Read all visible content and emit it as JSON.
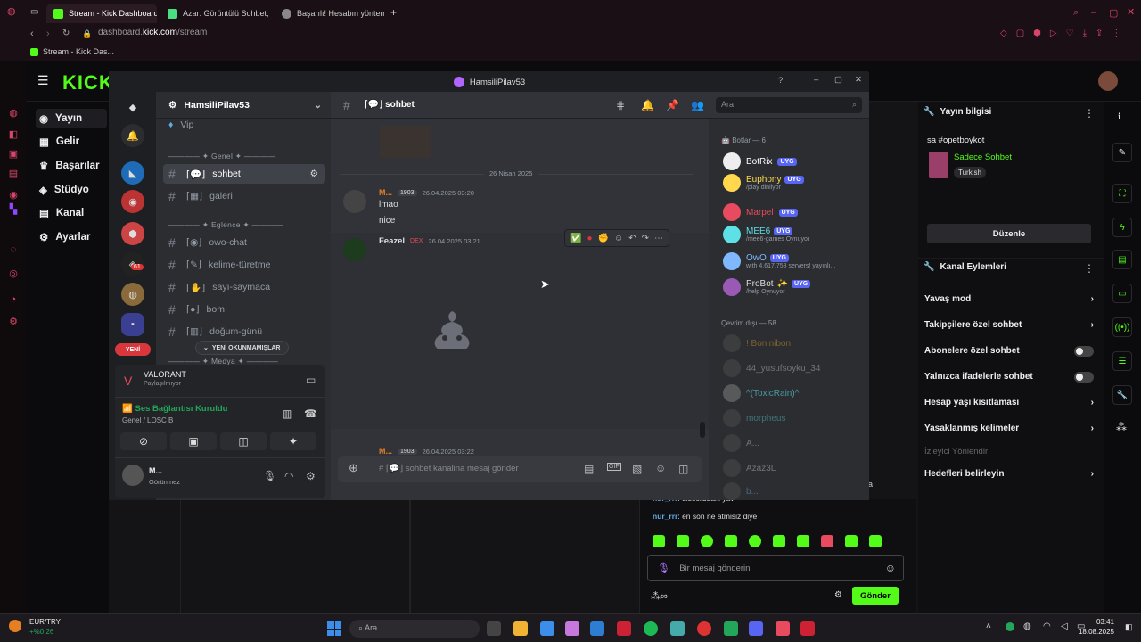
{
  "browser": {
    "tabs": [
      {
        "label": "Stream - Kick Dashboard",
        "color": "#53fc18",
        "active": true
      },
      {
        "label": "Azar: Görüntülü Sohbet, ",
        "color": "#4ade80",
        "active": false
      },
      {
        "label": "Başarılı! Hesabın yöntemi",
        "color": "#cccccc",
        "active": false
      }
    ],
    "url_prefix": "dashboard.",
    "url_domain": "kick.com",
    "url_path": "/stream",
    "bookmark": "Stream - Kick Das..."
  },
  "kick": {
    "logo": "KICK",
    "nav": [
      "Yayın",
      "Gelir",
      "Başarılar",
      "Stüdyo",
      "Kanal",
      "Ayarlar"
    ],
    "stream_info": {
      "title": "Yayın bilgisi",
      "stream_title": "sa #opetboykot",
      "category": "Sadece Sohbet",
      "language": "Turkish",
      "edit_button": "Düzenle"
    },
    "channel_actions": {
      "title": "Kanal Eylemleri",
      "items": [
        "Yavaş mod",
        "Takipçilere özel sohbet",
        "Abonelere özel sohbet",
        "Yalnızca ifadelerle sohbet",
        "Hesap yaşı kısıtlaması",
        "Yasaklanmış kelimeler"
      ],
      "viewer_header": "İzleyici Yönlendir",
      "goals": "Hedefleri belirleyin"
    },
    "chat": {
      "messages": [
        {
          "user": "nur_rrr",
          "text": "discorddaki yav"
        },
        {
          "user": "nur_rrr",
          "text": "en son ne atmisiz diye"
        }
      ],
      "partial": "ala",
      "placeholder": "Bir mesaj gönderin",
      "send": "Gönder"
    }
  },
  "discord": {
    "window_title": "HamsiliPilav53",
    "server_name": "HamsiliPilav53",
    "categories": [
      "Genel",
      "Eglence",
      "Medya"
    ],
    "channels": [
      {
        "name": "Vip"
      },
      {
        "name": "sohbet"
      },
      {
        "name": "galeri"
      },
      {
        "name": "owo-chat"
      },
      {
        "name": "kelime-türetme"
      },
      {
        "name": "sayı-saymaca"
      },
      {
        "name": "bom"
      },
      {
        "name": "doğum-günü"
      }
    ],
    "unread_pill": "YENİ OKUNMAMIŞLAR",
    "new_badge": "YENİ",
    "guild_badges": [
      "61"
    ],
    "activity": {
      "game": "VALORANT",
      "status": "Paylaşılmıyor"
    },
    "voice": {
      "status": "Ses Bağlantısı Kuruldu",
      "channel": "Genel / LOSC B"
    },
    "user": {
      "name": "M...",
      "status": "Görünmez"
    },
    "channel_header": "sohbet",
    "search_placeholder": "Ara",
    "date_divider": "26 Nisan 2025",
    "messages": [
      {
        "author": "M...",
        "level": "1903",
        "time": "26.04.2025 03:20",
        "lines": [
          "lmao",
          "nice"
        ]
      },
      {
        "author": "Feazel",
        "tag": "DEX",
        "time": "26.04.2025 03:21",
        "lines": []
      },
      {
        "author": "M...",
        "level": "1903",
        "time": "26.04.2025 03:22",
        "lines": []
      }
    ],
    "composer_placeholder": "sohbet kanalina mesaj gönder",
    "members": {
      "bots_header": "Botlar — 6",
      "bots": [
        {
          "name": "BotRix",
          "sub": "",
          "color": "#ffffff"
        },
        {
          "name": "Euphony",
          "sub": "/play dinliyor",
          "color": "#ffd84d"
        },
        {
          "name": "Marpel",
          "sub": "",
          "color": "#e84a5f"
        },
        {
          "name": "MEE6",
          "sub": "/mee6-games Oynuyor",
          "color": "#5de0e6"
        },
        {
          "name": "OwO",
          "sub": "with 4,617,758 servers! yayınlı...",
          "color": "#7fb8ff"
        },
        {
          "name": "ProBot",
          "sub": "/help Oynuyor",
          "color": "#9b59b6"
        }
      ],
      "bot_tag": "UYG",
      "offline_header": "Çevrim dışı — 58",
      "offline": [
        "! Boninibon",
        "44_yusufsoyku_34",
        "^(ToxicRain)^",
        "morpheus",
        "A...",
        "Azaz3L",
        "b..."
      ]
    }
  },
  "taskbar": {
    "ticker": "EUR/TRY",
    "ticker_change": "+%0,26",
    "search": "Ara",
    "time": "03:41",
    "date": "18.08.2025"
  }
}
